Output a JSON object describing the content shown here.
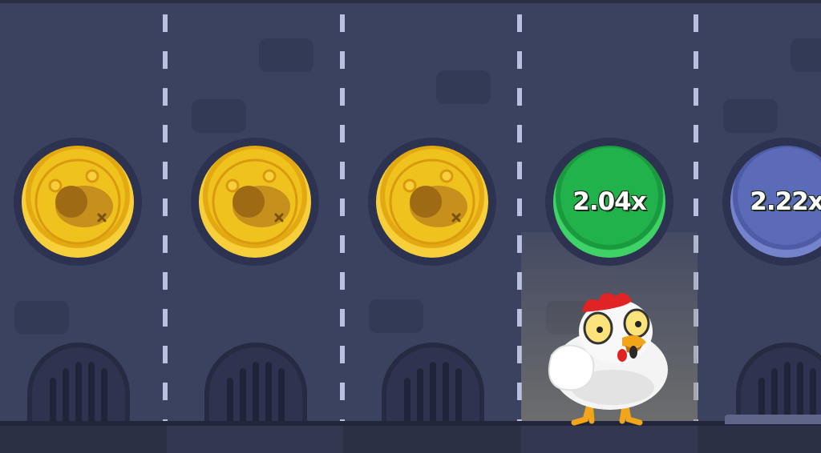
{
  "lanes": [
    {
      "state": "cooked",
      "multiplier": ""
    },
    {
      "state": "cooked",
      "multiplier": ""
    },
    {
      "state": "cooked",
      "multiplier": ""
    },
    {
      "state": "current",
      "multiplier": "2.04x"
    },
    {
      "state": "next",
      "multiplier": "2.22x"
    }
  ],
  "colors": {
    "background": "#3b4260",
    "gold_coin": "#f0c21e",
    "current_coin": "#22b24c",
    "next_coin": "#5b6bb8",
    "divider": "#b9c0e0"
  },
  "icons": [
    "roast-chicken-icon",
    "chicken-character"
  ]
}
